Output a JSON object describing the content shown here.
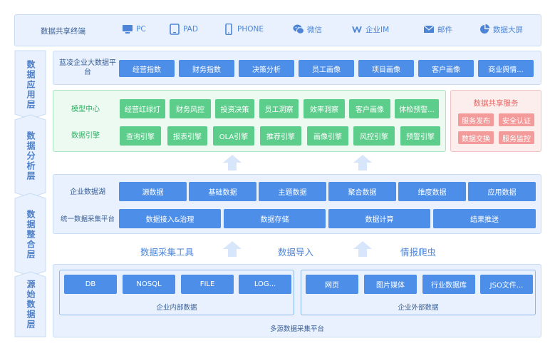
{
  "terminal": {
    "title": "数据共享终端",
    "items": [
      {
        "label": "PC",
        "icon": "monitor-icon"
      },
      {
        "label": "PAD",
        "icon": "tablet-icon"
      },
      {
        "label": "PHONE",
        "icon": "phone-icon"
      },
      {
        "label": "微信",
        "icon": "wechat-icon"
      },
      {
        "label": "企业IM",
        "icon": "im-icon"
      },
      {
        "label": "邮件",
        "icon": "mail-icon"
      },
      {
        "label": "数据大屏",
        "icon": "pie-chart-icon"
      }
    ]
  },
  "layers": [
    "数据应用层",
    "数据分析层",
    "数据整合层",
    "源始数据层"
  ],
  "application": {
    "label": "蓝凌企业大数据平台",
    "buttons": [
      "经营指数",
      "财务指数",
      "决策分析",
      "员工画像",
      "项目画像",
      "客户画像",
      "商业舆情..."
    ]
  },
  "analysis": {
    "model_label": "模型中心",
    "model_buttons": [
      "经营红绿灯",
      "财务风控",
      "投资决策",
      "员工洞察",
      "效率洞察",
      "客户画像",
      "体检预警..."
    ],
    "engine_label": "数据引擎",
    "engine_buttons": [
      "查询引擎",
      "报表引擎",
      "OLA引擎",
      "推荐引擎",
      "画像引擎",
      "风控引擎",
      "预警引擎"
    ]
  },
  "share_service": {
    "title": "数据共享服务",
    "buttons": [
      "服务发布",
      "安全认证",
      "数据交换",
      "服务监控"
    ]
  },
  "integration": {
    "lake_label": "企业数据湖",
    "lake_buttons": [
      "源数据",
      "基础数据",
      "主题数据",
      "聚合数据",
      "维度数据",
      "应用数据"
    ],
    "collect_label": "统一数据采集平台",
    "collect_buttons": [
      "数据接入&治理",
      "数据存储",
      "数据计算",
      "结果推送"
    ]
  },
  "flow": {
    "labels": [
      "数据采集工具",
      "数据导入",
      "情报爬虫"
    ]
  },
  "source": {
    "internal_buttons": [
      "DB",
      "NOSQL",
      "FILE",
      "LOG..."
    ],
    "internal_caption": "企业内部数据",
    "external_buttons": [
      "网页",
      "图片媒体",
      "行业数据库",
      "JSO文件..."
    ],
    "external_caption": "企业外部数据",
    "platform_caption": "多源数据采集平台"
  },
  "colors": {
    "blue_button": "#4d8ee9",
    "green_button": "#5dcd8b",
    "red_button": "#f39a9a",
    "panel_blue": "#e8f1fd",
    "panel_green": "#ecfaf1",
    "panel_red": "#fdeeee"
  }
}
